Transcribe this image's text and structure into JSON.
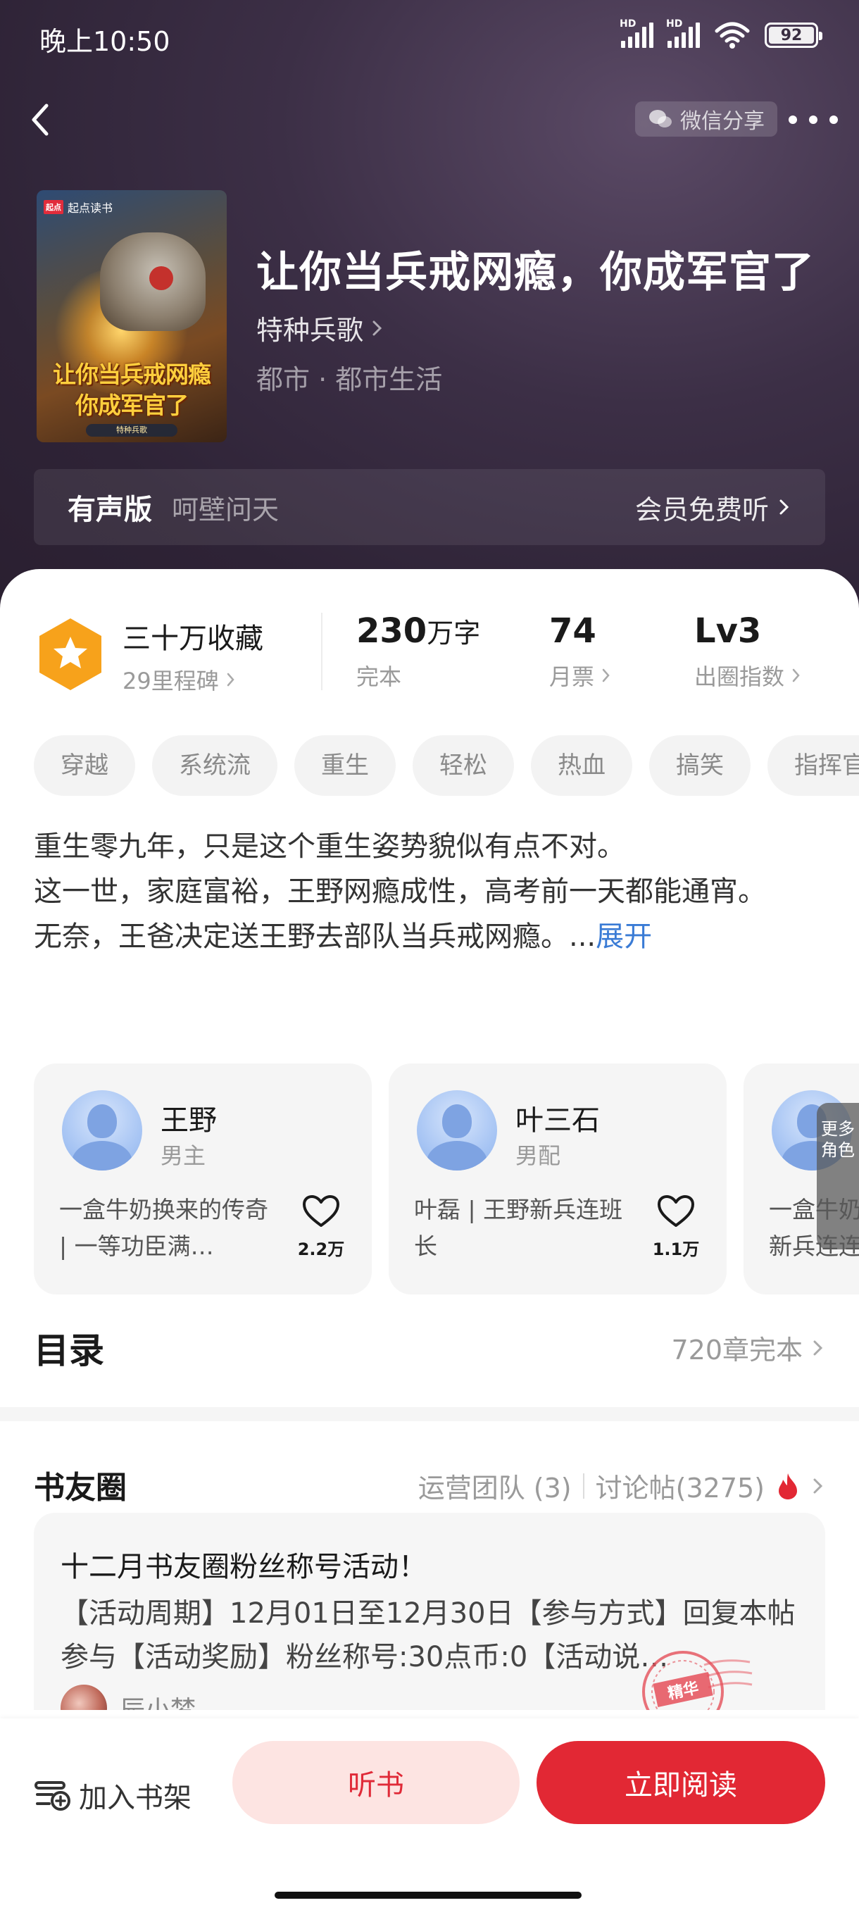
{
  "status_bar": {
    "time": "晚上10:50",
    "signal1_label": "HD",
    "signal2_label": "HD",
    "battery": "92"
  },
  "header": {
    "share_label": "微信分享"
  },
  "cover": {
    "publisher": "起点读书",
    "cover_title_line1": "让你当兵戒网瘾",
    "cover_title_line2": "你成军官了"
  },
  "book": {
    "title": "让你当兵戒网瘾，你成军官了",
    "author": "特种兵歌",
    "category": "都市 · 都市生活"
  },
  "audio": {
    "label": "有声版",
    "narrator": "呵壁问天",
    "action": "会员免费听"
  },
  "stats": {
    "favorites": "三十万收藏",
    "milestone": "29里程碑",
    "words_num": "230",
    "words_unit": "万字",
    "words_label": "完本",
    "tickets_num": "74",
    "tickets_label": "月票",
    "level_num": "Lv3",
    "level_label": "出圈指数"
  },
  "tags": [
    "穿越",
    "系统流",
    "重生",
    "轻松",
    "热血",
    "搞笑",
    "指挥官"
  ],
  "synopsis": {
    "line1": "重生零九年，只是这个重生姿势貌似有点不对。",
    "line2": "这一世，家庭富裕，王野网瘾成性，高考前一天都能通宵。",
    "line3": "无奈，王爸决定送王野去部队当兵戒网瘾。...",
    "expand": "展开"
  },
  "characters": [
    {
      "name": "王野",
      "role": "男主",
      "desc": "一盒牛奶换来的传奇 | 一等功臣满…",
      "likes": "2.2万"
    },
    {
      "name": "叶三石",
      "role": "男配",
      "desc": "叶磊 | 王野新兵连班长",
      "likes": "1.1万"
    },
    {
      "name": "",
      "role": "",
      "desc": "一盒牛奶 新兵连连",
      "likes": ""
    }
  ],
  "more_roles": "更多角色",
  "toc": {
    "title": "目录",
    "count": "720章完本"
  },
  "circle": {
    "title": "书友圈",
    "team": "运营团队 (3)",
    "posts": "讨论帖(3275)",
    "post_title": "十二月书友圈粉丝称号活动！",
    "post_body": "【活动周期】12月01日至12月30日【参与方式】回复本帖参与【活动奖励】粉丝称号:30点币:0【活动说…",
    "post_author": "辰小梦",
    "stamp_text": "精华"
  },
  "bottom": {
    "shelf": "加入书架",
    "listen": "听书",
    "read": "立即阅读"
  },
  "colors": {
    "accent_red": "#e22834",
    "light_red": "#fde4e2",
    "link_blue": "#3a7bd5",
    "medal_orange": "#f7a21b"
  }
}
